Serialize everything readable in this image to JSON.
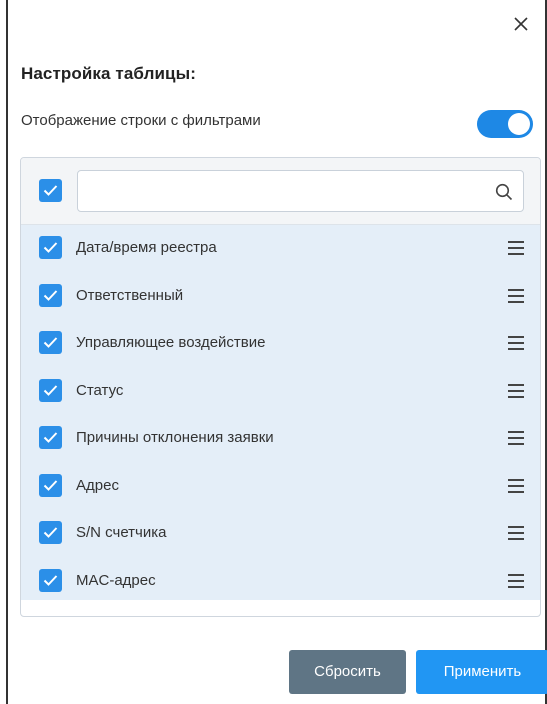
{
  "dialog": {
    "title": "Настройка таблицы:",
    "filter_row_toggle": {
      "label": "Отображение строки с фильтрами",
      "on": true
    },
    "search": {
      "value": "",
      "placeholder": ""
    },
    "select_all_checked": true,
    "columns": [
      {
        "label": "Дата/время реестра",
        "checked": true
      },
      {
        "label": "Ответственный",
        "checked": true
      },
      {
        "label": "Управляющее воздействие",
        "checked": true
      },
      {
        "label": "Статус",
        "checked": true
      },
      {
        "label": "Причины отклонения заявки",
        "checked": true
      },
      {
        "label": "Адрес",
        "checked": true
      },
      {
        "label": "S/N счетчика",
        "checked": true
      },
      {
        "label": "MAC-адрес",
        "checked": true
      }
    ],
    "buttons": {
      "reset": "Сбросить",
      "apply": "Применить"
    }
  },
  "colors": {
    "accent": "#2196f3",
    "checkbox": "#2b8fe8",
    "reset_button": "#5f7585",
    "list_background": "#e4eef8"
  },
  "icons": {
    "close": "close-icon",
    "search": "search-icon",
    "checkbox": "check-icon",
    "drag": "drag-handle-icon"
  }
}
